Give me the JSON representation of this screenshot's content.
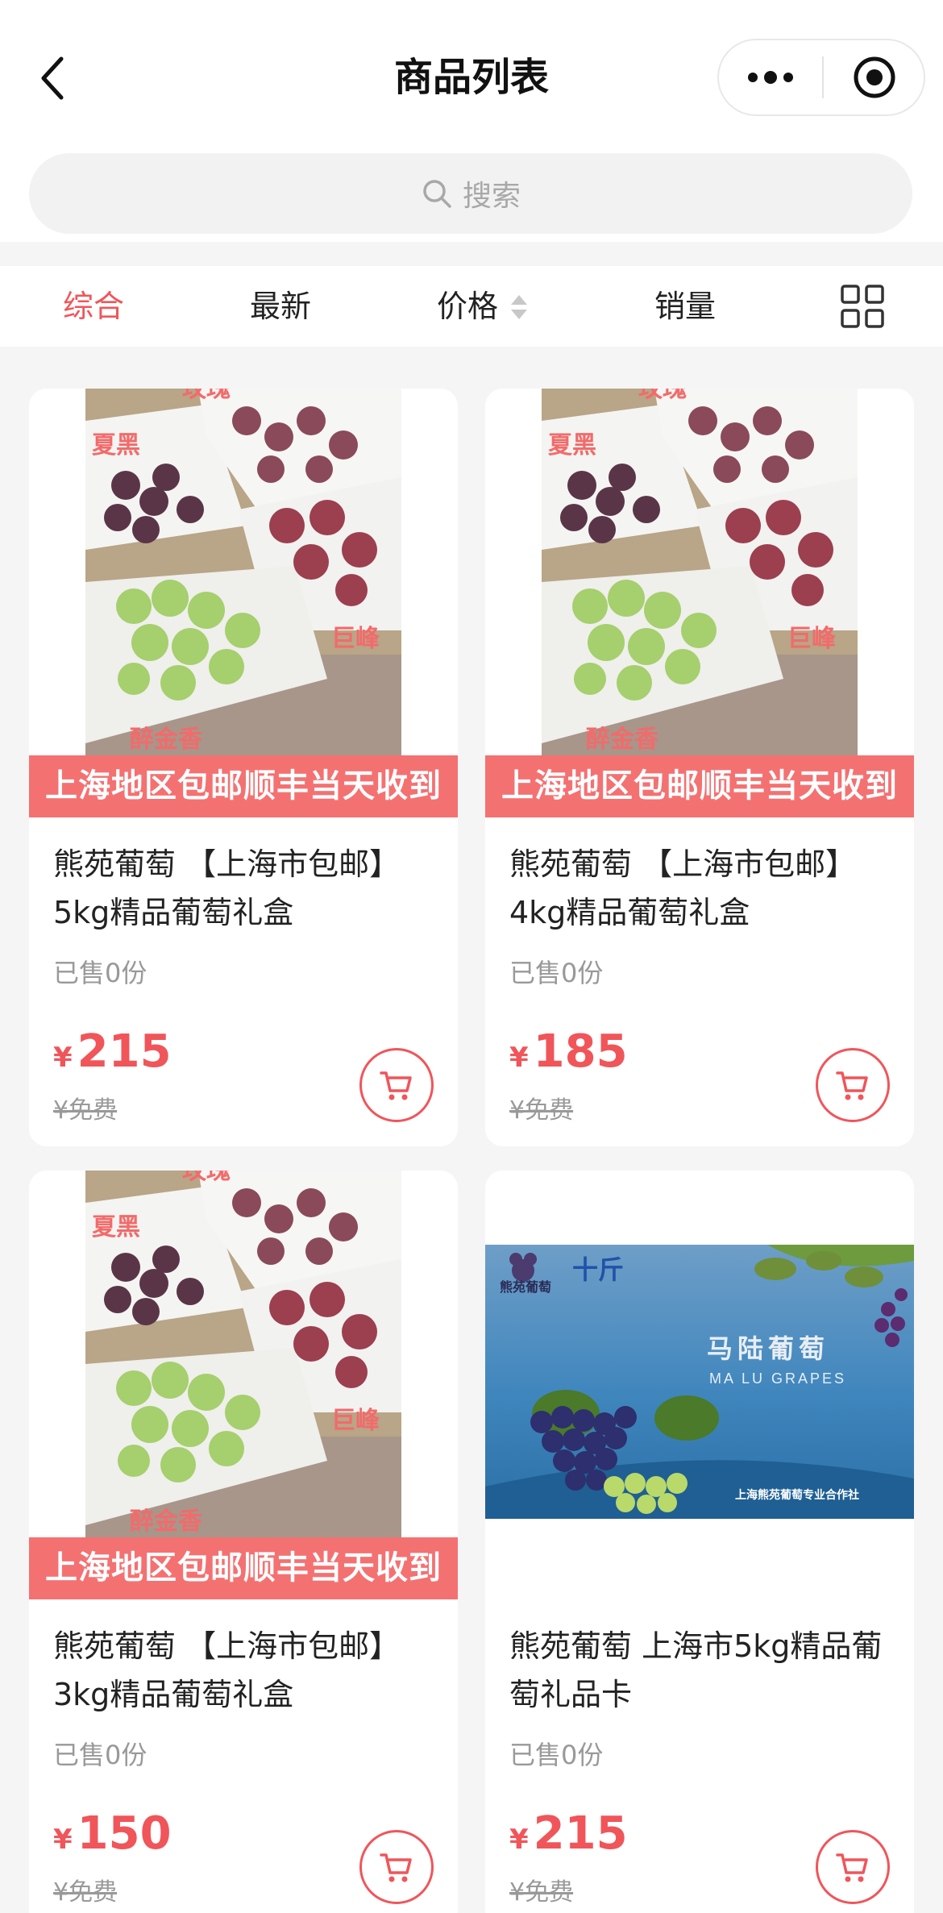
{
  "header": {
    "title": "商品列表",
    "search_placeholder": "搜索"
  },
  "tabs": [
    {
      "label": "综合",
      "active": true
    },
    {
      "label": "最新",
      "active": false
    },
    {
      "label": "价格",
      "active": false
    },
    {
      "label": "销量",
      "active": false
    }
  ],
  "colors": {
    "accent": "#f0555a",
    "banner": "#f47172"
  },
  "products": [
    {
      "banner": "上海地区包邮顺丰当天收到",
      "photo_labels": {
        "top": "玫瑰",
        "left": "夏黑",
        "right": "巨峰",
        "bottom": "醉金香"
      },
      "name": "熊苑葡萄 【上海市包邮】5kg精品葡萄礼盒",
      "sold": "已售0份",
      "currency": "¥",
      "price": "215",
      "original": "¥免费"
    },
    {
      "banner": "上海地区包邮顺丰当天收到",
      "photo_labels": {
        "top": "玫瑰",
        "left": "夏黑",
        "right": "巨峰",
        "bottom": "醉金香"
      },
      "name": "熊苑葡萄 【上海市包邮】4kg精品葡萄礼盒",
      "sold": "已售0份",
      "currency": "¥",
      "price": "185",
      "original": "¥免费"
    },
    {
      "banner": "上海地区包邮顺丰当天收到",
      "photo_labels": {
        "top": "玫瑰",
        "left": "夏黑",
        "right": "巨峰",
        "bottom": "醉金香"
      },
      "name": "熊苑葡萄 【上海市包邮】3kg精品葡萄礼盒",
      "sold": "已售0份",
      "currency": "¥",
      "price": "150",
      "original": "¥免费"
    },
    {
      "gift_card": {
        "brand": "熊苑葡萄",
        "weight": "十斤",
        "title_cn": "马陆葡萄",
        "title_en": "MA LU GRAPES",
        "footer": "上海熊苑葡萄专业合作社"
      },
      "name": "熊苑葡萄 上海市5kg精品葡萄礼品卡",
      "sold": "已售0份",
      "currency": "¥",
      "price": "215",
      "original": "¥免费"
    }
  ]
}
